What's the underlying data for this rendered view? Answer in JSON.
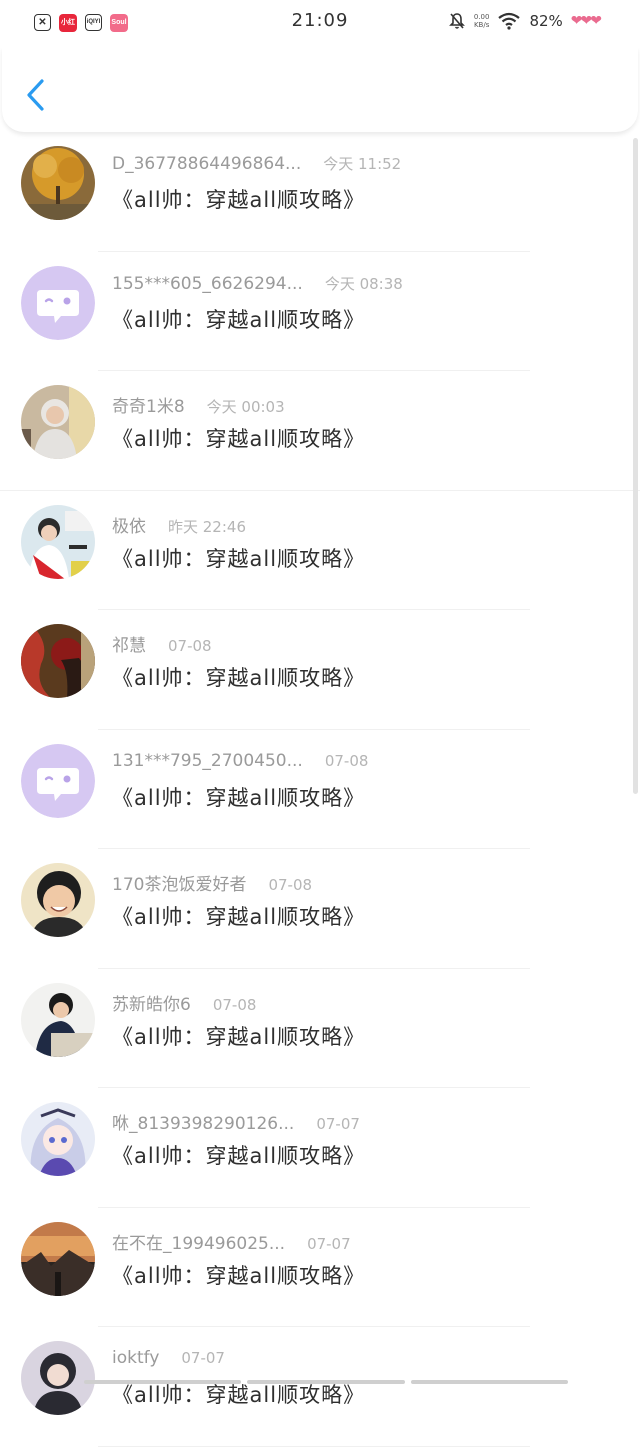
{
  "status_bar": {
    "time": "21:09",
    "network_speed": "0.00",
    "network_unit": "KB/s",
    "battery": "82%",
    "apps": [
      "x-icon",
      "xiaohongshu",
      "iqiyi",
      "soul"
    ]
  },
  "header": {
    "back_icon": "chevron-left-icon",
    "accent_color": "#2a9bf0"
  },
  "conversations": [
    {
      "name": "D_36778864496864...",
      "time": "今天 11:52",
      "message": "《all帅：穿越all顺攻略》",
      "avatar": "photo-autumn-tree"
    },
    {
      "name": "155***605_6626294...",
      "time": "今天 08:38",
      "message": "《all帅：穿越all顺攻略》",
      "avatar": "default-chat-avatar"
    },
    {
      "name": "奇奇1米8",
      "time": "今天 00:03",
      "message": "《all帅：穿越all顺攻略》",
      "avatar": "photo-person-hoodie"
    },
    {
      "name": "极依",
      "time": "昨天 22:46",
      "message": "《all帅：穿越all顺攻略》",
      "avatar": "photo-singer"
    },
    {
      "name": "祁慧",
      "time": "07-08",
      "message": "《all帅：穿越all顺攻略》",
      "avatar": "photo-red-figure"
    },
    {
      "name": "131***795_2700450...",
      "time": "07-08",
      "message": "《all帅：穿越all顺攻略》",
      "avatar": "default-chat-avatar"
    },
    {
      "name": "170茶泡饭爱好者",
      "time": "07-08",
      "message": "《all帅：穿越all顺攻略》",
      "avatar": "photo-smiling-person"
    },
    {
      "name": "苏新皓你6",
      "time": "07-08",
      "message": "《all帅：穿越all顺攻略》",
      "avatar": "photo-boy-desk"
    },
    {
      "name": "咻_8139398290126...",
      "time": "07-07",
      "message": "《all帅：穿越all顺攻略》",
      "avatar": "anime-girl"
    },
    {
      "name": "在不在_199496025...",
      "time": "07-07",
      "message": "《all帅：穿越all顺攻略》",
      "avatar": "photo-sunset"
    },
    {
      "name": "ioktfy",
      "time": "07-07",
      "message": "《all帅：穿越all顺攻略》",
      "avatar": "photo-girl"
    }
  ]
}
